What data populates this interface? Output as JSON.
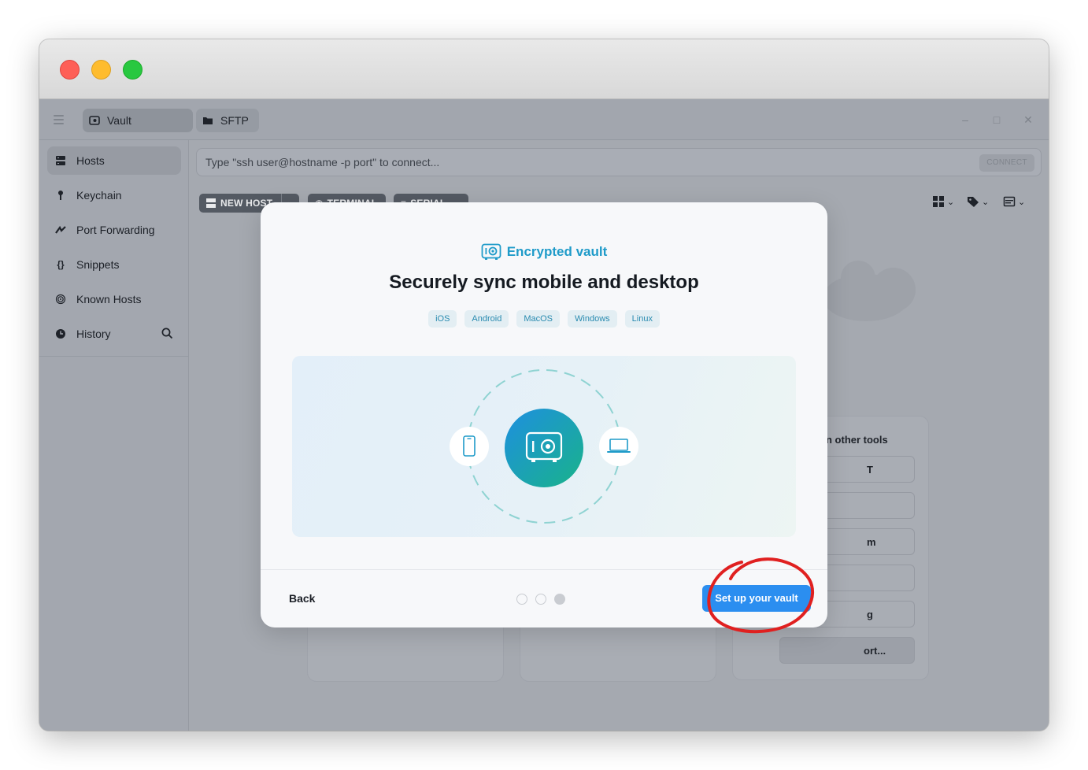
{
  "tabs": {
    "vault_label": "Vault",
    "sftp_label": "SFTP"
  },
  "sidebar": {
    "items": [
      {
        "label": "Hosts",
        "icon": "hosts-icon"
      },
      {
        "label": "Keychain",
        "icon": "key-icon"
      },
      {
        "label": "Port Forwarding",
        "icon": "port-forwarding-icon"
      },
      {
        "label": "Snippets",
        "icon": "braces-icon"
      },
      {
        "label": "Known Hosts",
        "icon": "fingerprint-icon"
      },
      {
        "label": "History",
        "icon": "history-icon"
      }
    ]
  },
  "connect": {
    "placeholder": "Type \"ssh user@hostname -p port\" to connect...",
    "button_label": "CONNECT"
  },
  "toolbar": {
    "new_host_label": "NEW HOST",
    "terminal_label": "TERMINAL",
    "serial_label": "SERIAL"
  },
  "background_panel": {
    "title_fragment": "n other tools",
    "row_fragments": [
      "T",
      "",
      "m",
      "",
      "g",
      "ort..."
    ]
  },
  "modal": {
    "eyebrow": "Encrypted vault",
    "headline": "Securely sync mobile and desktop",
    "platforms": [
      "iOS",
      "Android",
      "MacOS",
      "Windows",
      "Linux"
    ],
    "back_label": "Back",
    "primary_label": "Set up your vault",
    "page_count": 3,
    "current_page": 3
  },
  "colors": {
    "accent": "#2b8ef0",
    "eyebrow": "#1f9bc9",
    "annotation": "#e02020"
  }
}
